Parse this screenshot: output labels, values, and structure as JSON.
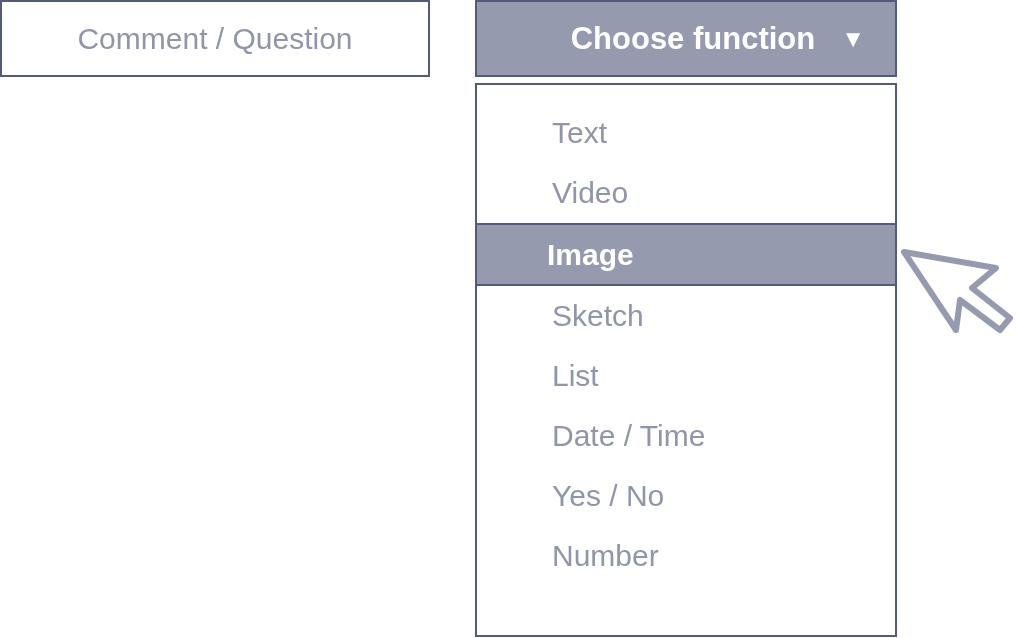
{
  "comment_field": {
    "placeholder": "Comment / Question"
  },
  "dropdown": {
    "label": "Choose function",
    "caret": "▼",
    "expanded": true,
    "options": [
      {
        "label": "Text",
        "selected": false
      },
      {
        "label": "Video",
        "selected": false
      },
      {
        "label": "Image",
        "selected": true
      },
      {
        "label": "Sketch",
        "selected": false
      },
      {
        "label": "List",
        "selected": false
      },
      {
        "label": "Date / Time",
        "selected": false
      },
      {
        "label": "Yes / No",
        "selected": false
      },
      {
        "label": "Number",
        "selected": false
      }
    ]
  }
}
